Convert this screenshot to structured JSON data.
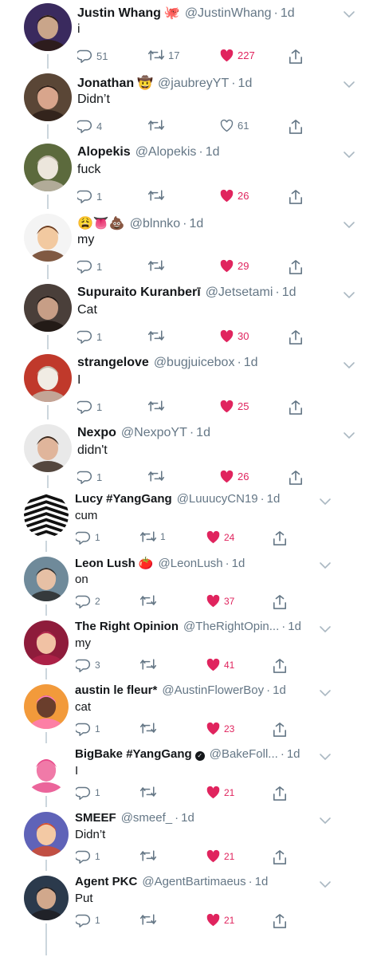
{
  "tweets": [
    {
      "name": "Justin Whang",
      "emoji": "🐙",
      "handle": "@JustinWhang",
      "time": "1d",
      "text": "i",
      "replies": "51",
      "retweets": "17",
      "likes": "227",
      "liked": true,
      "avatar": {
        "bg": "#3a2a5e",
        "skin": "#c9a58a",
        "hair": "#2b1a12"
      }
    },
    {
      "name": "Jonathan",
      "emoji": "🤠",
      "handle": "@jaubreyYT",
      "time": "1d",
      "text": "Didn’t",
      "replies": "4",
      "retweets": "",
      "likes": "61",
      "liked": false,
      "avatar": {
        "bg": "#5a4636",
        "skin": "#d8a58c",
        "hair": "#2d1f18"
      }
    },
    {
      "name": "Alopekis",
      "emoji": "",
      "handle": "@Alopekis",
      "time": "1d",
      "text": "fuck",
      "replies": "1",
      "retweets": "",
      "likes": "26",
      "liked": true,
      "avatar": {
        "bg": "#5c6a3d",
        "skin": "#ece6dc",
        "hair": "#bfb6a8"
      }
    },
    {
      "name": "",
      "emoji": "😩👅💩",
      "handle": "@blnnko",
      "time": "1d",
      "text": "my",
      "replies": "1",
      "retweets": "",
      "likes": "29",
      "liked": true,
      "avatar": {
        "bg": "#f4f4f4",
        "skin": "#f2c9a0",
        "hair": "#6b3d22"
      }
    },
    {
      "name": "Supuraito Kuranberī",
      "emoji": "",
      "handle": "@Jetsetami",
      "time": "1d",
      "text": "Cat",
      "replies": "1",
      "retweets": "",
      "likes": "30",
      "liked": true,
      "avatar": {
        "bg": "#4a3f3a",
        "skin": "#c79e86",
        "hair": "#1c1512"
      }
    },
    {
      "name": "strangelove",
      "emoji": "",
      "handle": "@bugjuicebox",
      "time": "1d",
      "text": "I",
      "replies": "1",
      "retweets": "",
      "likes": "25",
      "liked": true,
      "avatar": {
        "bg": "#c0392b",
        "skin": "#f1ece4",
        "hair": "#c3b9a9"
      }
    },
    {
      "name": "Nexpo",
      "emoji": "",
      "handle": "@NexpoYT",
      "time": "1d",
      "text": "didn't",
      "replies": "1",
      "retweets": "",
      "likes": "26",
      "liked": true,
      "avatar": {
        "bg": "#e9e9e9",
        "skin": "#e0b59b",
        "hair": "#3a2a20"
      }
    },
    {
      "name": "Lucy #YangGang",
      "emoji": "",
      "handle": "@LuuucyCN19",
      "time": "1d",
      "text": "cum",
      "replies": "1",
      "retweets": "1",
      "likes": "24",
      "liked": true,
      "avatar": {
        "bg": "#ffffff",
        "skin": "#111111",
        "hair": "#111111"
      }
    },
    {
      "name": "Leon Lush",
      "emoji": "🍅",
      "handle": "@LeonLush",
      "time": "1d",
      "text": "on",
      "replies": "2",
      "retweets": "",
      "likes": "37",
      "liked": true,
      "avatar": {
        "bg": "#6f8a9a",
        "skin": "#e6c0a5",
        "hair": "#2b2b2b"
      }
    },
    {
      "name": "The Right Opinion",
      "emoji": "",
      "handle": "@TheRightOpin...",
      "time": "1d",
      "text": "my",
      "replies": "3",
      "retweets": "",
      "likes": "41",
      "liked": true,
      "avatar": {
        "bg": "#8e1c3b",
        "skin": "#f1c2a4",
        "hair": "#b1224a"
      }
    },
    {
      "name": "austin le fleur*",
      "emoji": "",
      "handle": "@AustinFlowerBoy",
      "time": "1d",
      "text": "cat",
      "replies": "1",
      "retweets": "",
      "likes": "23",
      "liked": true,
      "avatar": {
        "bg": "#f29a3b",
        "skin": "#6a3e2c",
        "hair": "#ff7ab8"
      }
    },
    {
      "name": "BigBake #YangGang",
      "emoji": "",
      "verified": true,
      "handle": "@BakeFoll...",
      "time": "1d",
      "text": "I",
      "replies": "1",
      "retweets": "",
      "likes": "21",
      "liked": true,
      "avatar": {
        "bg": "#ffffff",
        "skin": "#f07aa8",
        "hair": "#e84a8a"
      }
    },
    {
      "name": "SMEEF",
      "emoji": "",
      "handle": "@smeef_",
      "time": "1d",
      "text": "Didn’t",
      "replies": "1",
      "retweets": "",
      "likes": "21",
      "liked": true,
      "avatar": {
        "bg": "#5f63b8",
        "skin": "#f3c9a4",
        "hair": "#d24b2e"
      }
    },
    {
      "name": "Agent PKC",
      "emoji": "",
      "handle": "@AgentBartimaeus",
      "time": "1d",
      "text": "Put",
      "replies": "1",
      "retweets": "",
      "likes": "21",
      "liked": true,
      "avatar": {
        "bg": "#2b3a4c",
        "skin": "#d1a88c",
        "hair": "#1e1e22"
      }
    }
  ],
  "colors": {
    "like": "#e0245e",
    "muted": "#657786",
    "text": "#14171a",
    "line": "#ccd6dd"
  }
}
